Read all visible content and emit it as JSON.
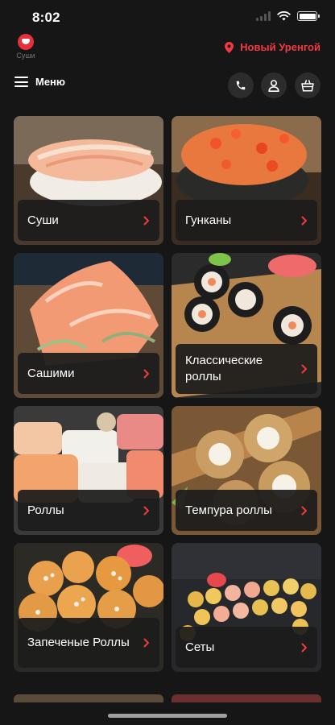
{
  "status_bar": {
    "time": "8:02"
  },
  "header": {
    "logo_text": "Суши",
    "city": "Новый Уренгой",
    "menu_label": "Меню"
  },
  "categories": [
    {
      "label": "Суши"
    },
    {
      "label": "Гунканы"
    },
    {
      "label": "Сашими"
    },
    {
      "label": "Классические роллы"
    },
    {
      "label": "Роллы"
    },
    {
      "label": "Темпура роллы"
    },
    {
      "label": "Запеченые Роллы"
    },
    {
      "label": "Сеты"
    }
  ],
  "colors": {
    "accent": "#f23a3f",
    "background": "#161616",
    "card_label_bg": "#1c1c1c",
    "button_bg": "#2c2c2c"
  },
  "icons": {
    "location": "map-pin-icon",
    "menu": "hamburger-icon",
    "phone": "phone-icon",
    "profile": "user-icon",
    "cart": "basket-icon",
    "chevron": "chevron-right-icon"
  }
}
